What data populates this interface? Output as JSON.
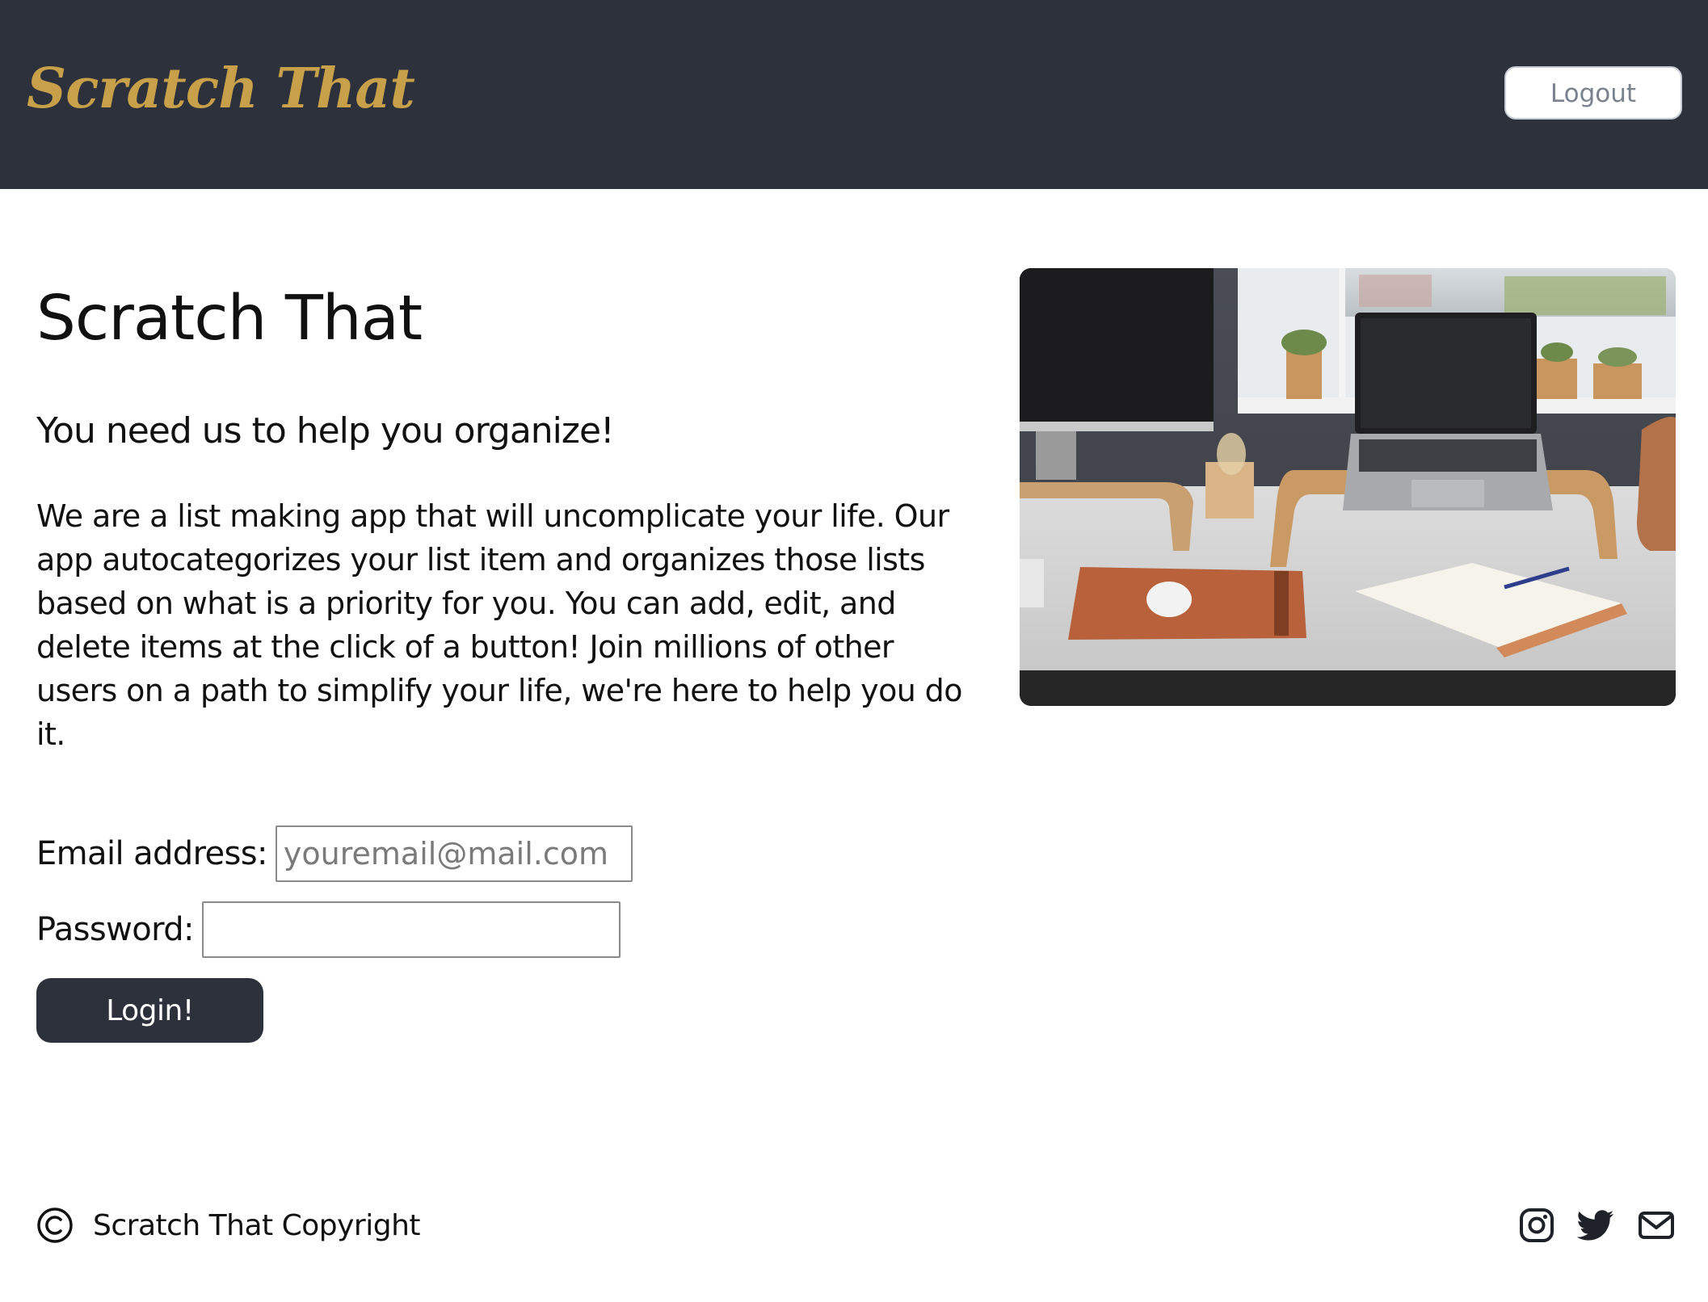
{
  "header": {
    "logo": "Scratch That",
    "logout_label": "Logout",
    "background_color": "#2c313b",
    "logo_color": "#c9a04a"
  },
  "hero": {
    "title": "Scratch That",
    "subtitle": "You need us to help you organize!",
    "description": "We are a list making app that will uncomplicate your life. Our app autocategorizes your list item and organizes those lists based on what is a priority for you. You can add, edit, and delete items at the click of a button! Join millions of other users on a path to simplify your life, we're here to help you do it.",
    "image_icon": "desk-workspace-photo"
  },
  "login_form": {
    "email_label": "Email address:",
    "email_placeholder": "youremail@mail.com",
    "email_value": "",
    "password_label": "Password:",
    "password_value": "",
    "submit_label": "Login!"
  },
  "footer": {
    "copyright_icon": "copyright-icon",
    "copyright_text": "Scratch That Copyright",
    "social_icons": [
      "instagram-icon",
      "twitter-icon",
      "mail-icon"
    ]
  }
}
